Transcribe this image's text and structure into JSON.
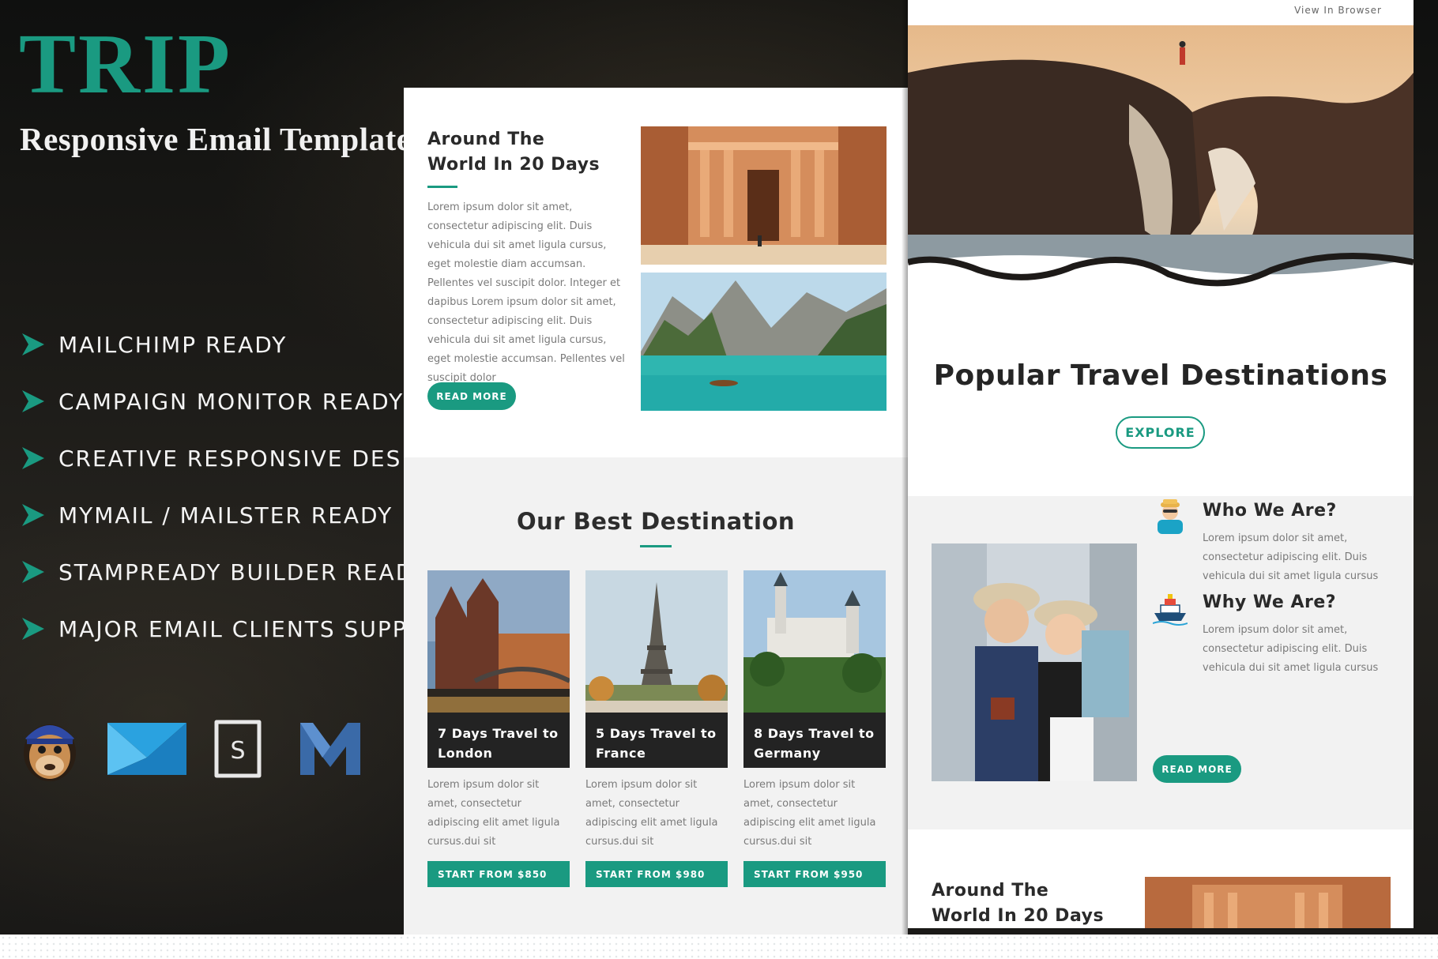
{
  "brand": {
    "logo": "TRIP",
    "subtitle": "Responsive Email Template",
    "accent_color": "#1a9a81"
  },
  "features": [
    "MAILCHIMP READY",
    "CAMPAIGN MONITOR READY",
    "CREATIVE RESPONSIVE DESIGN",
    "MYMAIL / MAILSTER READY",
    "STAMPREADY BUILDER READY",
    "MAJOR EMAIL CLIENTS SUPPORT"
  ],
  "platform_icons": [
    "mailchimp-icon",
    "campaign-monitor-icon",
    "stampready-icon",
    "mymail-icon"
  ],
  "email_preview_mid": {
    "intro": {
      "title": "Around The World In 20 Days",
      "body": "Lorem ipsum dolor sit amet, consectetur adipiscing elit. Duis vehicula dui sit amet ligula cursus, eget molestie diam accumsan. Pellentes vel suscipit dolor. Integer et dapibus Lorem ipsum dolor sit amet, consectetur adipiscing elit. Duis vehicula dui sit amet ligula cursus, eget molestie accumsan. Pellentes vel suscipit dolor",
      "button": "READ MORE"
    },
    "destinations": {
      "title": "Our Best Destination",
      "cards": [
        {
          "caption": "7 Days Travel to London",
          "desc": "Lorem ipsum dolor sit amet, consectetur adipiscing elit amet ligula cursus.dui sit",
          "button": "START FROM $850"
        },
        {
          "caption": "5 Days Travel to France",
          "desc": "Lorem ipsum dolor sit amet, consectetur adipiscing elit amet ligula cursus.dui sit",
          "button": "START FROM $980"
        },
        {
          "caption": "8 Days Travel to Germany",
          "desc": "Lorem ipsum dolor sit amet, consectetur adipiscing elit amet ligula cursus.dui sit",
          "button": "START FROM $950"
        }
      ]
    }
  },
  "email_preview_right": {
    "view_in_browser": "View In Browser",
    "hero_title": "Popular Travel Destinations",
    "explore_button": "EXPLORE",
    "who": {
      "title": "Who We Are?",
      "body": "Lorem ipsum dolor sit amet, consectetur adipiscing elit. Duis vehicula dui sit amet ligula cursus"
    },
    "why": {
      "title": "Why We Are?",
      "body": "Lorem ipsum dolor sit amet, consectetur adipiscing elit. Duis vehicula dui sit amet ligula cursus"
    },
    "read_more": "READ MORE",
    "bottom_title": "Around The World In 20 Days"
  }
}
